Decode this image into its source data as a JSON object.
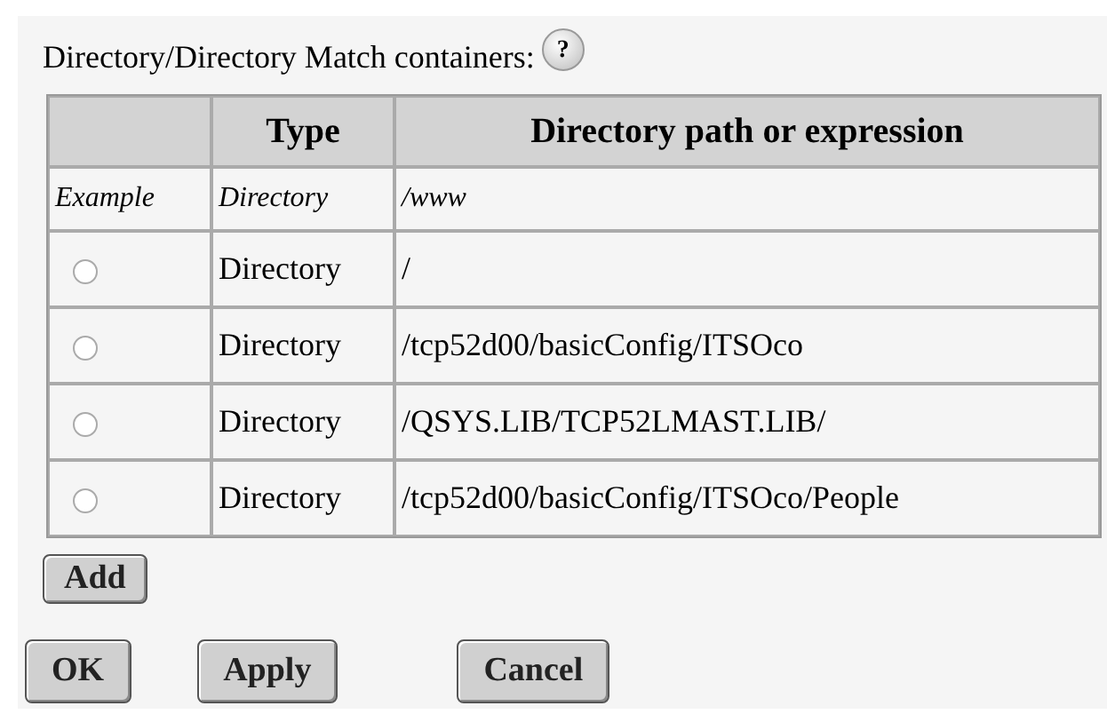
{
  "heading": "Directory/Directory Match containers:",
  "help_icon": "?",
  "table": {
    "columns": [
      "",
      "Type",
      "Directory path or expression"
    ],
    "example": {
      "label": "Example",
      "type": "Directory",
      "path": "/www"
    },
    "rows": [
      {
        "selected": false,
        "type": "Directory",
        "path": "/"
      },
      {
        "selected": false,
        "type": "Directory",
        "path": "/tcp52d00/basicConfig/ITSOco"
      },
      {
        "selected": false,
        "type": "Directory",
        "path": "/QSYS.LIB/TCP52LMAST.LIB/"
      },
      {
        "selected": false,
        "type": "Directory",
        "path": "/tcp52d00/basicConfig/ITSOco/People"
      }
    ]
  },
  "add_button": "Add",
  "buttons": [
    "OK",
    "Apply",
    "Cancel"
  ]
}
